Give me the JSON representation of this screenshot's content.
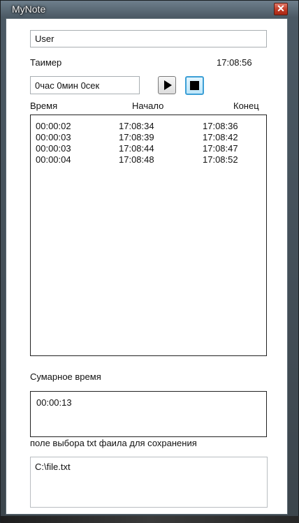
{
  "window": {
    "title": "MyNote",
    "close_glyph": "✕"
  },
  "user_field": {
    "value": "User"
  },
  "timer": {
    "label": "Таимер",
    "clock": "17:08:56",
    "duration_value": "0час 0мин 0сек",
    "play_icon": "play-icon",
    "stop_icon": "stop-icon"
  },
  "table": {
    "headers": [
      "Время",
      "Начало",
      "Конец"
    ],
    "rows": [
      [
        "00:00:02",
        "17:08:34",
        "17:08:36"
      ],
      [
        "00:00:03",
        "17:08:39",
        "17:08:42"
      ],
      [
        "00:00:03",
        "17:08:44",
        "17:08:47"
      ],
      [
        "00:00:04",
        "17:08:48",
        "17:08:52"
      ]
    ]
  },
  "summary": {
    "label": "Сумарное время",
    "value": "00:00:13"
  },
  "file": {
    "label": "поле выбора txt фаила для сохранения",
    "value": "C:\\file.txt"
  },
  "colors": {
    "accent": "#3c9fd6",
    "close": "#c23a25"
  }
}
